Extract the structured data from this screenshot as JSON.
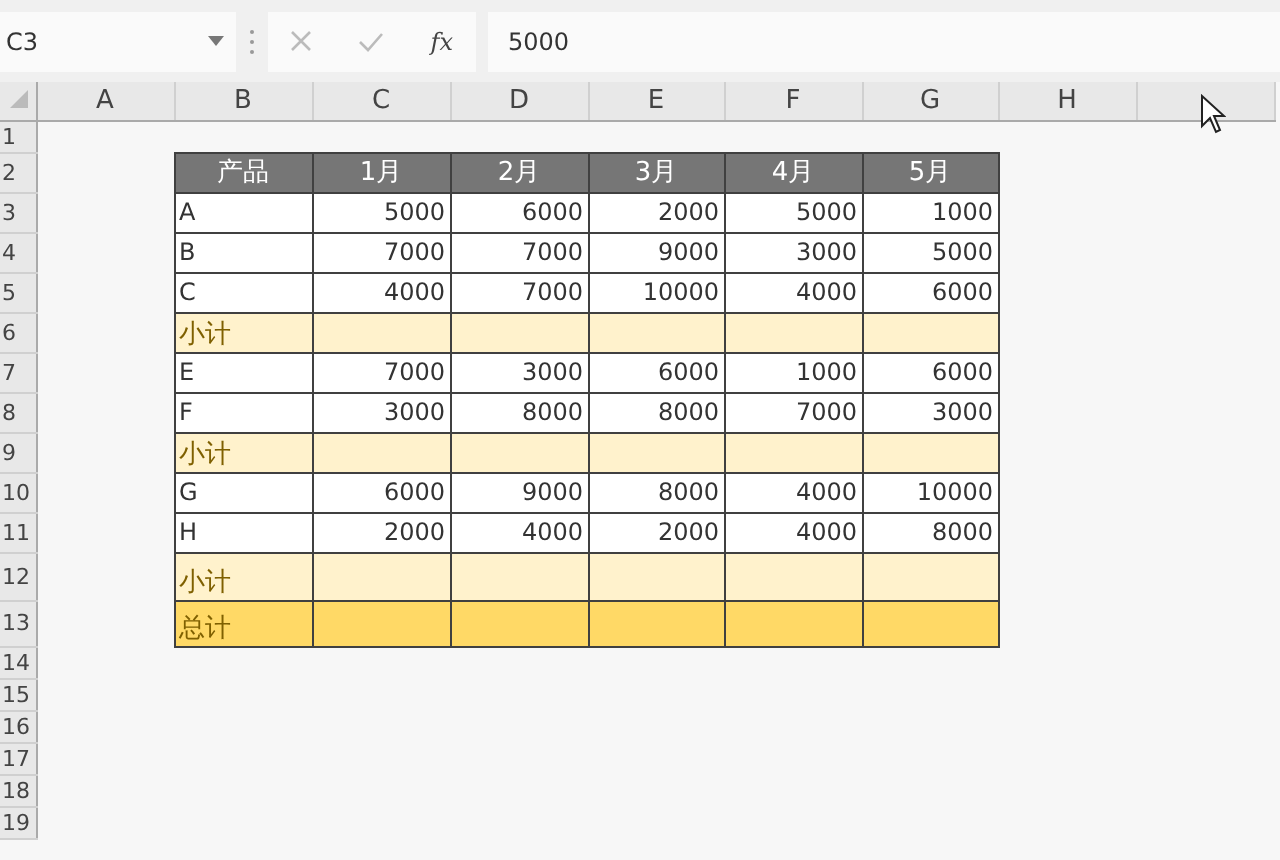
{
  "formula_bar": {
    "name_box": "C3",
    "function_label": "fx",
    "formula": "5000"
  },
  "columns": [
    "A",
    "B",
    "C",
    "D",
    "E",
    "F",
    "G",
    "H"
  ],
  "rows": [
    {
      "number": "1",
      "kind": "blank"
    },
    {
      "number": "2",
      "kind": "header",
      "cells": [
        "产品",
        "1月",
        "2月",
        "3月",
        "4月",
        "5月"
      ]
    },
    {
      "number": "3",
      "kind": "item",
      "cells": [
        "A",
        "5000",
        "6000",
        "2000",
        "5000",
        "1000"
      ]
    },
    {
      "number": "4",
      "kind": "item",
      "cells": [
        "B",
        "7000",
        "7000",
        "9000",
        "3000",
        "5000"
      ]
    },
    {
      "number": "5",
      "kind": "item",
      "cells": [
        "C",
        "4000",
        "7000",
        "10000",
        "4000",
        "6000"
      ]
    },
    {
      "number": "6",
      "kind": "subtotal",
      "cells": [
        "小计"
      ]
    },
    {
      "number": "7",
      "kind": "item",
      "cells": [
        "E",
        "7000",
        "3000",
        "6000",
        "1000",
        "6000"
      ]
    },
    {
      "number": "8",
      "kind": "item",
      "cells": [
        "F",
        "3000",
        "8000",
        "8000",
        "7000",
        "3000"
      ]
    },
    {
      "number": "9",
      "kind": "subtotal",
      "cells": [
        "小计"
      ]
    },
    {
      "number": "10",
      "kind": "item",
      "cells": [
        "G",
        "6000",
        "9000",
        "8000",
        "4000",
        "10000"
      ]
    },
    {
      "number": "11",
      "kind": "item",
      "cells": [
        "H",
        "2000",
        "4000",
        "2000",
        "4000",
        "8000"
      ]
    },
    {
      "number": "12",
      "kind": "subtotal_tall",
      "cells": [
        "小计"
      ]
    },
    {
      "number": "13",
      "kind": "total",
      "cells": [
        "总计"
      ]
    },
    {
      "number": "14",
      "kind": "blank"
    },
    {
      "number": "15",
      "kind": "blank"
    },
    {
      "number": "16",
      "kind": "blank"
    },
    {
      "number": "17",
      "kind": "blank"
    },
    {
      "number": "18",
      "kind": "blank"
    },
    {
      "number": "19",
      "kind": "blank"
    }
  ]
}
